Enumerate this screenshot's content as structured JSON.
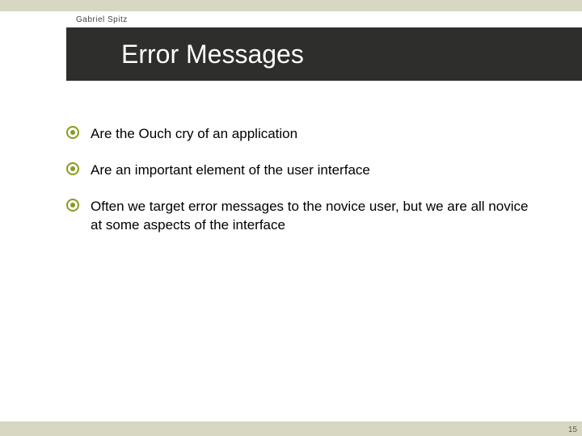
{
  "author": "Gabriel Spitz",
  "title": "Error Messages",
  "bullets": [
    "Are the Ouch cry of an application",
    "Are an important element of the user interface",
    "Often we target error messages to the novice user, but we are all novice at some aspects of the interface"
  ],
  "page_number": "15",
  "colors": {
    "accent": "#8a9a1f",
    "title_bg": "#2e2e2c",
    "band": "#d7d7c2"
  }
}
